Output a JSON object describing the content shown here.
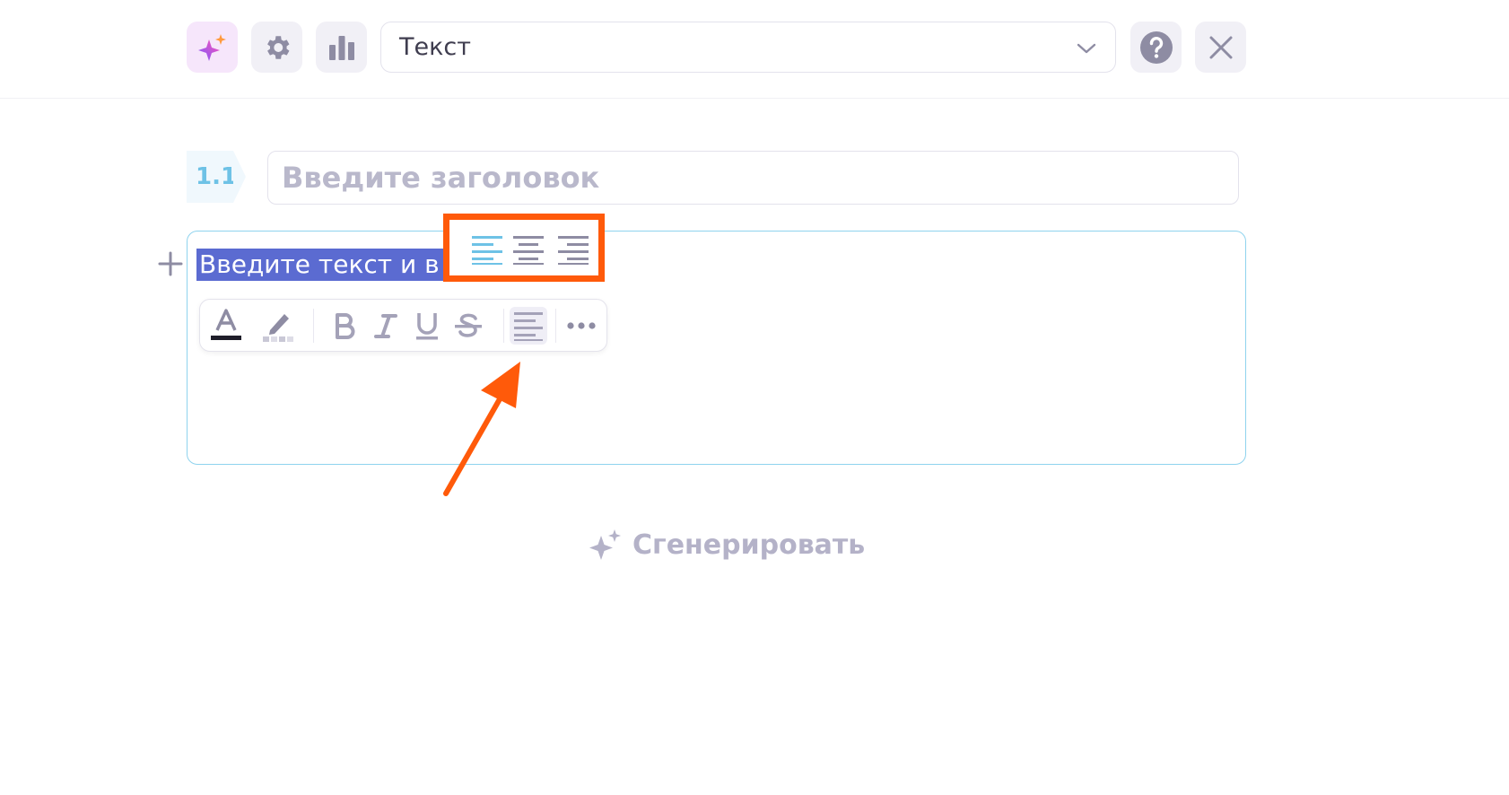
{
  "topbar": {
    "select": {
      "value": "Текст"
    }
  },
  "section": {
    "number": "1.1",
    "title_placeholder": "Введите заголовок"
  },
  "editor": {
    "selected_text": "Введите текст и в"
  },
  "generate": {
    "label": "Сгенерировать"
  },
  "colors": {
    "accent_orange": "#ff5a0a",
    "selection": "#5b6bd1",
    "editor_border": "#8fd3ee",
    "active_align": "#6ec2e6",
    "icon_gray": "#8e8ca3"
  }
}
